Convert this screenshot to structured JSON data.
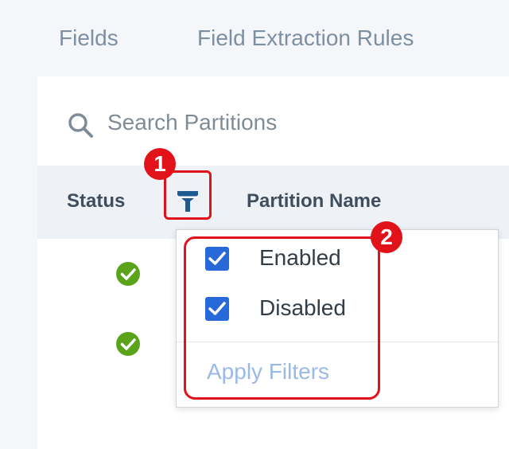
{
  "tabs": [
    {
      "label": "Fields"
    },
    {
      "label": "Field Extraction Rules"
    }
  ],
  "search": {
    "placeholder": "Search Partitions",
    "icon": "search-icon"
  },
  "table": {
    "columns": [
      "Status",
      "Partition Name"
    ],
    "rows": [
      {
        "status": "enabled",
        "status_icon": "check-circle-icon"
      },
      {
        "status": "enabled",
        "status_icon": "check-circle-icon"
      },
      {
        "status": "",
        "status_icon": ""
      }
    ]
  },
  "filter": {
    "icon": "filter-icon",
    "options": [
      {
        "label": "Enabled",
        "checked": true
      },
      {
        "label": "Disabled",
        "checked": true
      }
    ],
    "apply_label": "Apply Filters"
  },
  "annotations": [
    "1",
    "2"
  ],
  "colors": {
    "accent": "#2769d8",
    "success": "#5aa31b",
    "annotation": "#e1121a",
    "filter_icon": "#1f5a92",
    "apply_disabled": "#9bb9e7"
  }
}
